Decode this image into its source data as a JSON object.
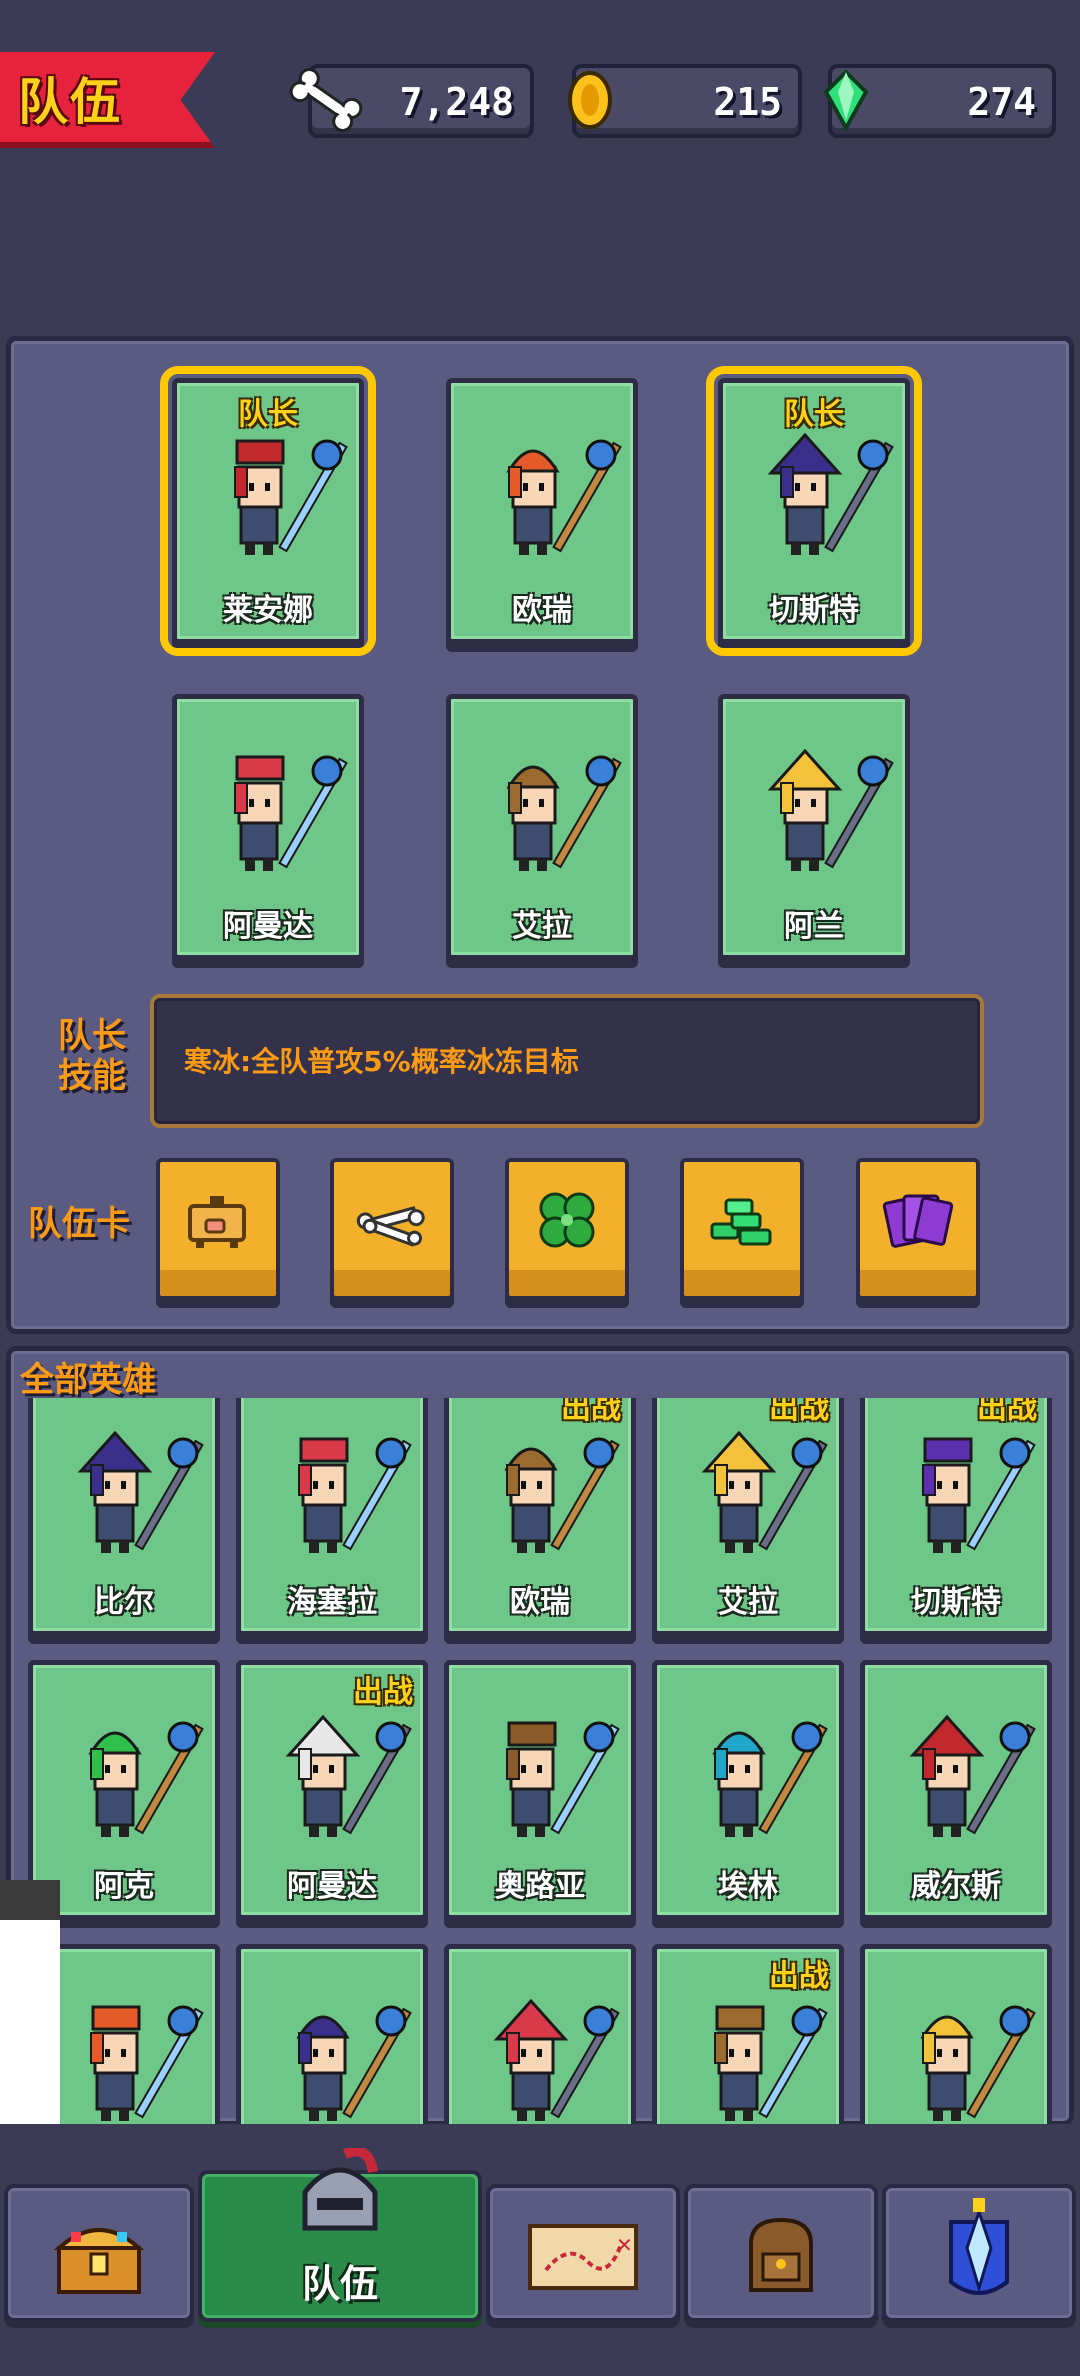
{
  "header": {
    "title": "队伍",
    "resources": [
      {
        "name": "bone",
        "icon": "bone-icon",
        "value": "7,248"
      },
      {
        "name": "gold",
        "icon": "gold-coin-icon",
        "value": "215"
      },
      {
        "name": "gem",
        "icon": "green-gem-icon",
        "value": "274"
      }
    ]
  },
  "team": {
    "leader_tag": "队长",
    "members": [
      {
        "name": "莱安娜",
        "leader": true
      },
      {
        "name": "欧瑞",
        "leader": false
      },
      {
        "name": "切斯特",
        "leader": true
      },
      {
        "name": "阿曼达",
        "leader": false
      },
      {
        "name": "艾拉",
        "leader": false
      },
      {
        "name": "阿兰",
        "leader": false
      }
    ],
    "skill_label": "队长技能",
    "skill_label_line1": "队长",
    "skill_label_line2": "技能",
    "skill_text": "寒冰:全队普攻5%概率冰冻目标",
    "cards_label": "队伍卡",
    "cards": [
      "piggy-bank-icon",
      "bone-pile-icon",
      "clover-icon",
      "gem-pile-icon",
      "card-deck-icon"
    ]
  },
  "all_heroes": {
    "label": "全部英雄",
    "battle_tag": "出战",
    "rows": [
      [
        {
          "name": "比尔",
          "in_battle": false
        },
        {
          "name": "海塞拉",
          "in_battle": false
        },
        {
          "name": "欧瑞",
          "in_battle": true
        },
        {
          "name": "艾拉",
          "in_battle": true
        },
        {
          "name": "切斯特",
          "in_battle": true
        }
      ],
      [
        {
          "name": "阿克",
          "in_battle": false
        },
        {
          "name": "阿曼达",
          "in_battle": true
        },
        {
          "name": "奥路亚",
          "in_battle": false
        },
        {
          "name": "埃林",
          "in_battle": false
        },
        {
          "name": "威尔斯",
          "in_battle": false
        }
      ],
      [
        {
          "name": "",
          "in_battle": false
        },
        {
          "name": "",
          "in_battle": false
        },
        {
          "name": "",
          "in_battle": false
        },
        {
          "name": "",
          "in_battle": true
        },
        {
          "name": "",
          "in_battle": false
        }
      ]
    ]
  },
  "nav": {
    "items": [
      {
        "icon": "treasure-chest-icon",
        "label": ""
      },
      {
        "icon": "knight-helmet-icon",
        "label": "队伍",
        "active": true
      },
      {
        "icon": "treasure-map-icon",
        "label": ""
      },
      {
        "icon": "backpack-icon",
        "label": ""
      },
      {
        "icon": "crystal-shrine-icon",
        "label": ""
      }
    ]
  },
  "colors": {
    "background": "#3c3b56",
    "panel": "#5b5a80",
    "card_green": "#6ec788",
    "leader_outline": "#ffc800",
    "accent_orange": "#ff9a14",
    "title_red": "#e7223d",
    "nav_active": "#2a8a4a"
  }
}
